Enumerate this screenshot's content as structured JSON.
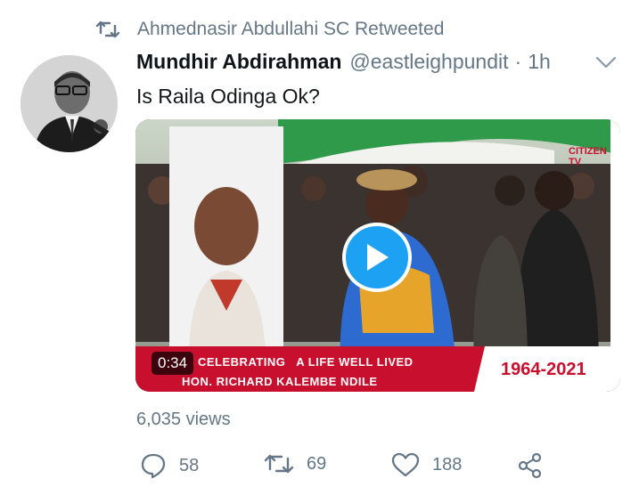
{
  "retweet": {
    "text": "Ahmednasir Abdullahi SC Retweeted",
    "icon": "retweet-icon"
  },
  "tweet": {
    "author_name": "Mundhir Abdirahman",
    "handle": "@eastleighpundit",
    "separator": "·",
    "time": "1h",
    "text": "Is Raila Odinga Ok?"
  },
  "media": {
    "duration": "0:34",
    "banner_line1": "CELEBRATING   A LIFE WELL LIVED",
    "banner_line2": "HON. RICHARD KALEMBE NDILE",
    "banner_years": "1964-2021",
    "watermark": "CITIZEN TV"
  },
  "views": "6,035 views",
  "actions": {
    "reply_count": "58",
    "retweet_count": "69",
    "like_count": "188"
  },
  "colors": {
    "accent": "#1da1f2",
    "muted": "#657786",
    "banner_red": "#d0102a"
  }
}
